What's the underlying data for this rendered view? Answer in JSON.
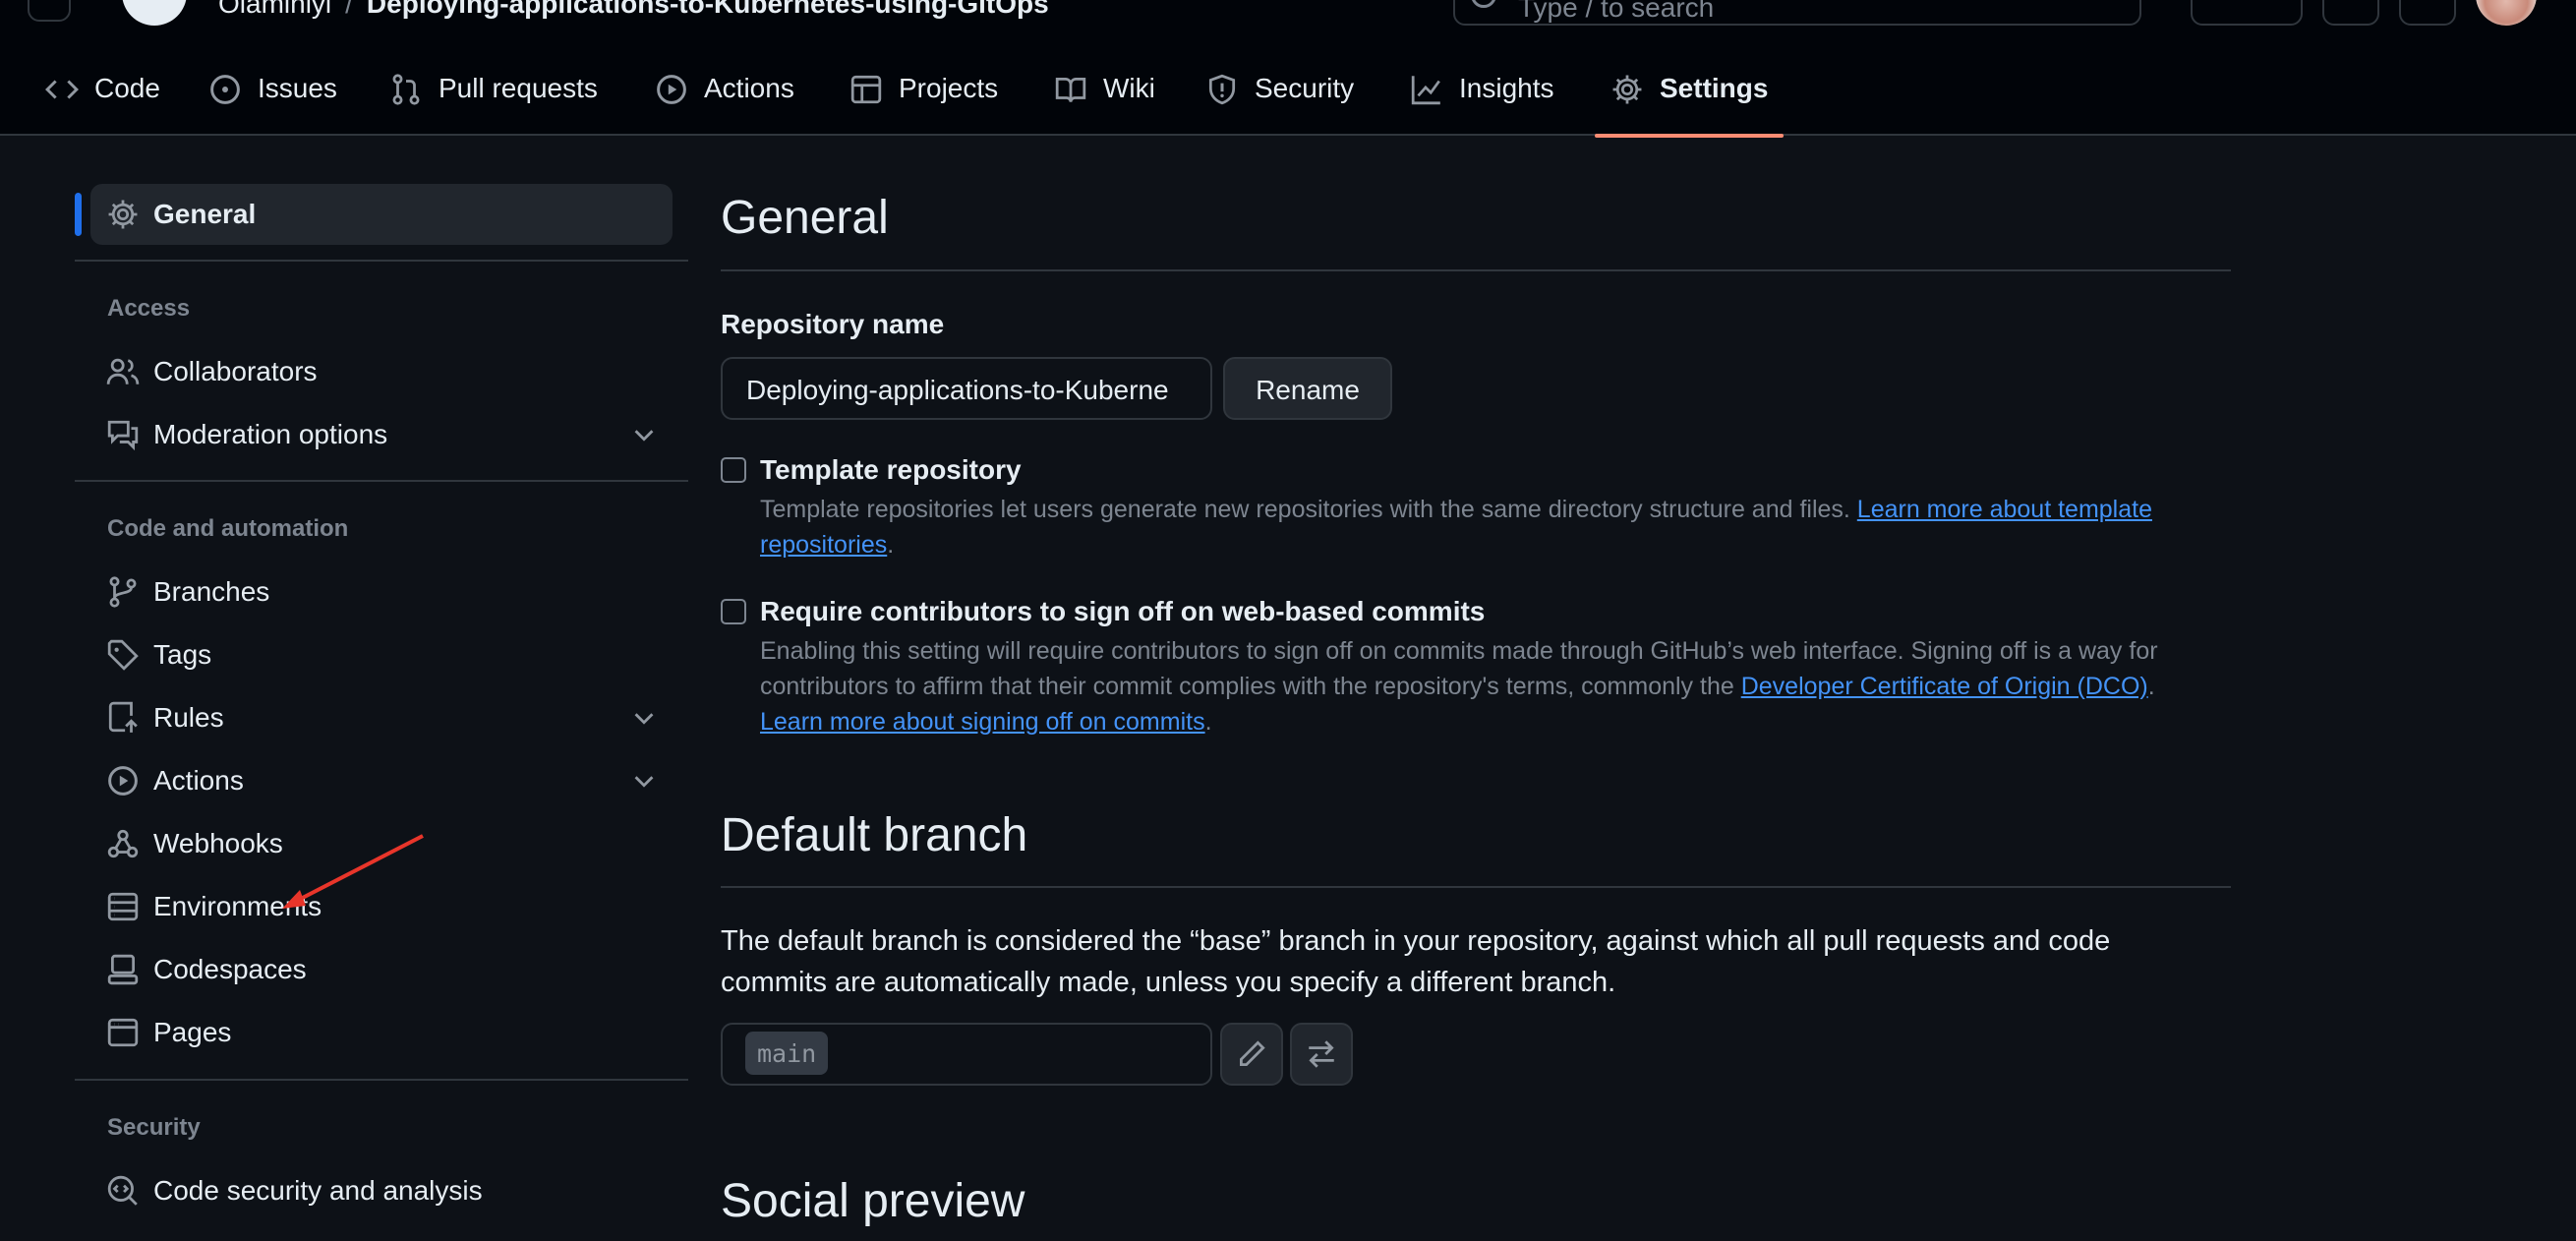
{
  "header": {
    "owner": "Olaminiyi",
    "separator": "/",
    "repo": "Deploying-applications-to-Kubernetes-using-GitOps",
    "search_placeholder": "Type / to search"
  },
  "tabs": [
    {
      "label": "Code",
      "icon": "code-icon"
    },
    {
      "label": "Issues",
      "icon": "issue-opened-icon"
    },
    {
      "label": "Pull requests",
      "icon": "git-pull-request-icon"
    },
    {
      "label": "Actions",
      "icon": "play-icon"
    },
    {
      "label": "Projects",
      "icon": "table-icon"
    },
    {
      "label": "Wiki",
      "icon": "book-icon"
    },
    {
      "label": "Security",
      "icon": "shield-icon"
    },
    {
      "label": "Insights",
      "icon": "graph-icon"
    },
    {
      "label": "Settings",
      "icon": "gear-icon",
      "active": true
    }
  ],
  "sidebar": {
    "general": "General",
    "access_heading": "Access",
    "access_items": [
      {
        "label": "Collaborators",
        "icon": "people-icon"
      },
      {
        "label": "Moderation options",
        "icon": "comment-discussion-icon",
        "expandable": true
      }
    ],
    "code_heading": "Code and automation",
    "code_items": [
      {
        "label": "Branches",
        "icon": "git-branch-icon"
      },
      {
        "label": "Tags",
        "icon": "tag-icon"
      },
      {
        "label": "Rules",
        "icon": "repo-push-icon",
        "expandable": true
      },
      {
        "label": "Actions",
        "icon": "play-icon",
        "expandable": true
      },
      {
        "label": "Webhooks",
        "icon": "webhook-icon"
      },
      {
        "label": "Environments",
        "icon": "server-icon"
      },
      {
        "label": "Codespaces",
        "icon": "codespaces-icon"
      },
      {
        "label": "Pages",
        "icon": "browser-icon"
      }
    ],
    "security_heading": "Security",
    "security_items": [
      {
        "label": "Code security and analysis",
        "icon": "codescan-icon"
      }
    ]
  },
  "main": {
    "general_title": "General",
    "repo_name_label": "Repository name",
    "repo_name_value": "Deploying-applications-to-Kuberne",
    "rename_button": "Rename",
    "template": {
      "title": "Template repository",
      "desc": "Template repositories let users generate new repositories with the same directory structure and files. ",
      "link_1": "Learn more about template",
      "link_2": "repositories",
      "period": "."
    },
    "signoff": {
      "title": "Require contributors to sign off on web-based commits",
      "desc_1": "Enabling this setting will require contributors to sign off on commits made through GitHub’s web interface. Signing off is a way for",
      "desc_2": "contributors to affirm that their commit complies with the repository's terms, commonly the ",
      "dco_link": "Developer Certificate of Origin (DCO)",
      "period": ".",
      "learn_link": "Learn more about signing off on commits"
    },
    "default_branch_title": "Default branch",
    "default_branch_desc_1": "The default branch is considered the “base” branch in your repository, against which all pull requests and code",
    "default_branch_desc_2": "commits are automatically made, unless you specify a different branch.",
    "default_branch_value": "main",
    "social_preview_title": "Social preview"
  },
  "colors": {
    "background": "#0d1117",
    "accent_tab": "#fd8c73",
    "active_bar": "#1f6feb",
    "link": "#4493f8",
    "annotation_arrow": "#e8352a"
  }
}
